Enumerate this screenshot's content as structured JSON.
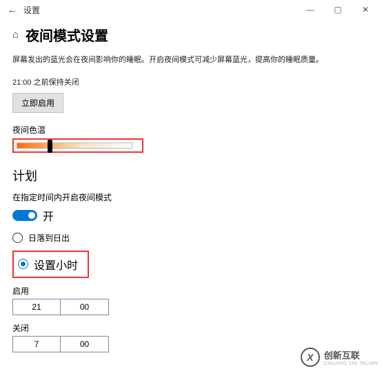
{
  "window": {
    "title": "设置"
  },
  "page": {
    "heading": "夜间模式设置",
    "desc": "屏幕发出的蓝光会在夜间影响你的睡眠。开启夜间模式可减少屏幕蓝光，提高你的睡眠质量。",
    "status_line": "21:00 之前保持关闭",
    "turn_on_now": "立即启用"
  },
  "slider": {
    "label": "夜间色温"
  },
  "schedule": {
    "heading": "计划",
    "desc": "在指定时间内开启夜间模式",
    "toggle_state": "开",
    "option_sun": "日落到日出",
    "option_hours": "设置小时"
  },
  "times": {
    "on_label": "启用",
    "on_h": "21",
    "on_m": "00",
    "off_label": "关闭",
    "off_h": "7",
    "off_m": "00"
  },
  "watermark": {
    "brand": "创新互联",
    "sub": "CHUANG XIN TALIAN"
  }
}
